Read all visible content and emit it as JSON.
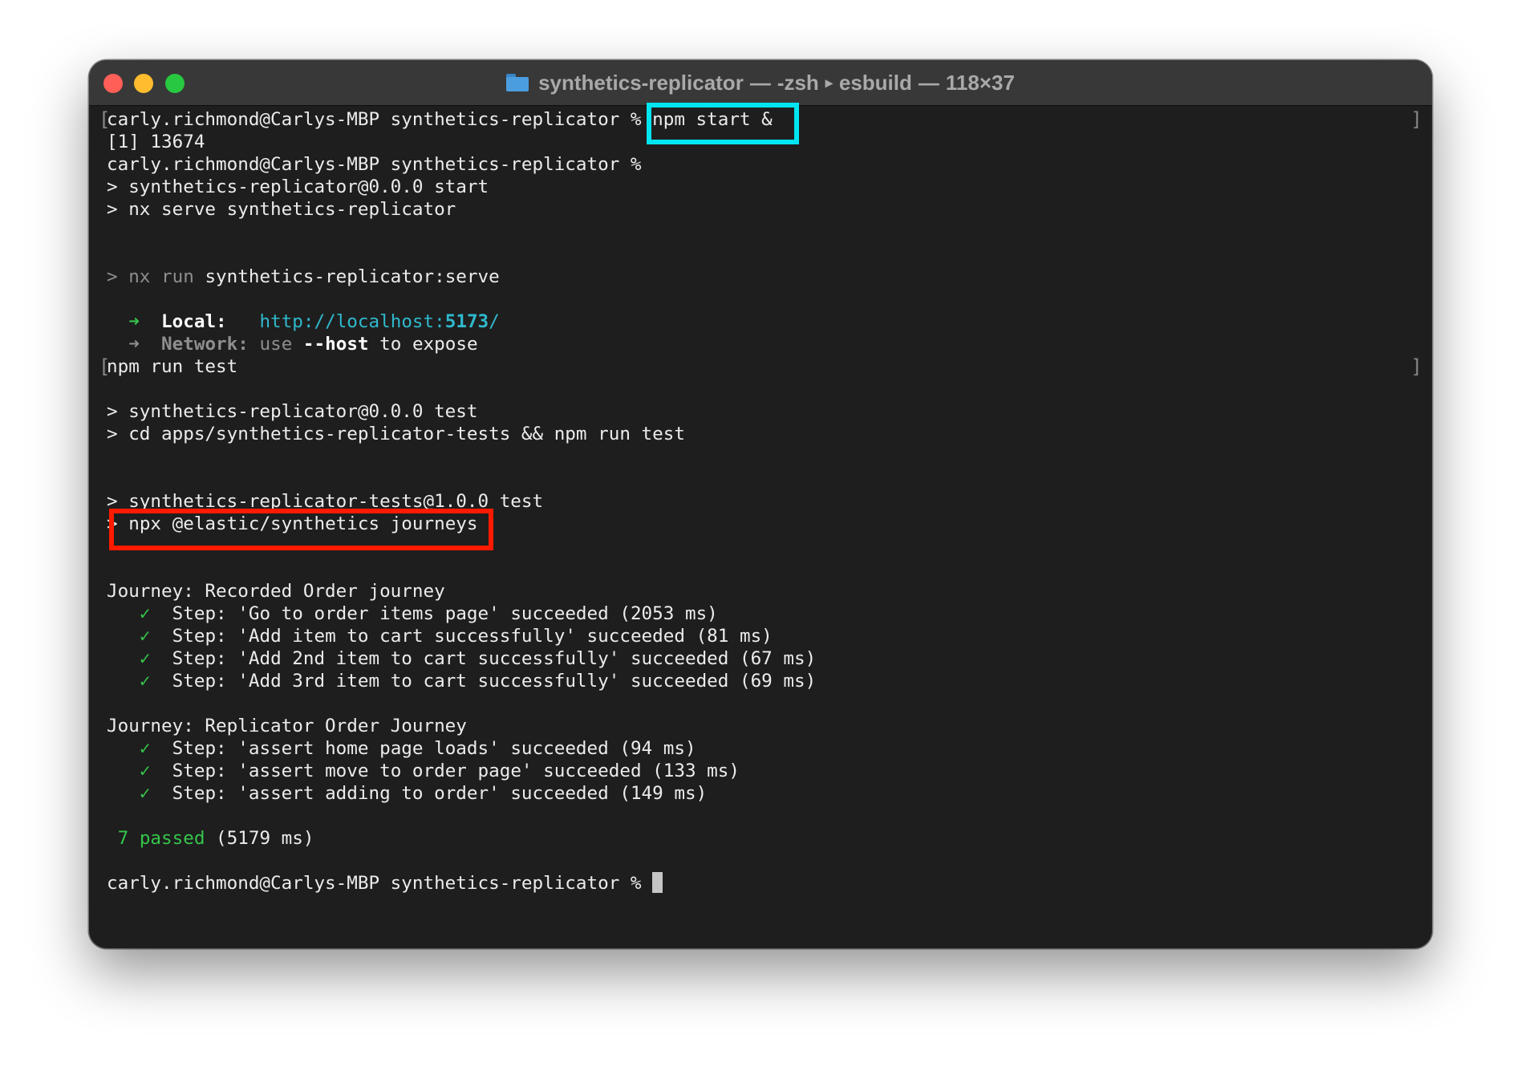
{
  "window": {
    "title": "synthetics-replicator — -zsh ▸ esbuild — 118×37",
    "title_name": "synthetics-replicator",
    "title_sep": "—",
    "title_shell": "-zsh",
    "title_arrow": "▸",
    "title_process": "esbuild",
    "title_size": "118×37",
    "folder_icon": "folder-icon"
  },
  "terminal": {
    "prompt": "carly.richmond@Carlys-MBP synthetics-replicator %",
    "cmd_start": "npm start &",
    "job_line": "[1] 13674",
    "start_script": "> synthetics-replicator@0.0.0 start",
    "start_cmd": "> nx serve synthetics-replicator",
    "nx_run_prefix": "> nx run",
    "nx_run_target": "synthetics-replicator:serve",
    "arrow": "➜",
    "local_label": "Local:",
    "local_url_prefix": "http://localhost:",
    "local_url_port": "5173",
    "local_url_suffix": "/",
    "network_label": "Network:",
    "network_use": "use",
    "network_flag": "--host",
    "network_rest": "to expose",
    "cmd_test": "npm run test",
    "test_script": "> synthetics-replicator@0.0.0 test",
    "test_cmd": "> cd apps/synthetics-replicator-tests && npm run test",
    "tests_script": "> synthetics-replicator-tests@1.0.0 test",
    "gt": ">",
    "journeys_cmd": "npx @elastic/synthetics journeys",
    "check": "✓",
    "journey1": {
      "title": "Journey: Recorded Order journey",
      "steps": [
        "Step: 'Go to order items page' succeeded (2053 ms)",
        "Step: 'Add item to cart successfully' succeeded (81 ms)",
        "Step: 'Add 2nd item to cart successfully' succeeded (67 ms)",
        "Step: 'Add 3rd item to cart successfully' succeeded (69 ms)"
      ]
    },
    "journey2": {
      "title": "Journey: Replicator Order Journey",
      "steps": [
        "Step: 'assert home page loads' succeeded (94 ms)",
        "Step: 'assert move to order page' succeeded (133 ms)",
        "Step: 'assert adding to order' succeeded (149 ms)"
      ]
    },
    "summary_passed": "7 passed",
    "summary_time": "(5179 ms)",
    "bracket_open": "[",
    "bracket_close": "]"
  },
  "colors": {
    "highlight_cyan": "#00e5f0",
    "highlight_red": "#ff1a00",
    "success_green": "#34c54a",
    "link_cyan": "#2fb9cd",
    "terminal_bg": "#1e1e1e"
  }
}
